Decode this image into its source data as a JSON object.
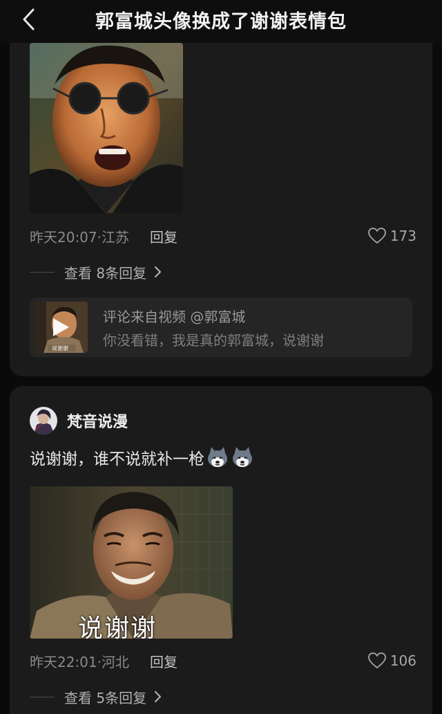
{
  "header": {
    "back_icon": "chevron-left-icon",
    "title": "郭富城头像换成了谢谢表情包"
  },
  "comments": [
    {
      "time_location": "昨天20:07·江苏",
      "reply_label": "回复",
      "like_count": "173",
      "view_replies": "查看 8条回复",
      "source": {
        "line1": "评论来自视频 @郭富城",
        "line2": "你没看错，我是真的郭富城，说谢谢",
        "thumb_caption": "说谢谢"
      }
    },
    {
      "username": "梵音说漫",
      "text": "说谢谢，谁不说就补一枪",
      "emojis": [
        "husky-emoji",
        "husky-emoji"
      ],
      "image_caption": "说谢谢",
      "time_location": "昨天22:01·河北",
      "reply_label": "回复",
      "like_count": "106",
      "view_replies": "查看 5条回复"
    }
  ],
  "colors": {
    "background": "#0a0a0a",
    "card": "#1b1b1b",
    "source_box": "#252525",
    "muted_text": "#8a8a8a"
  }
}
